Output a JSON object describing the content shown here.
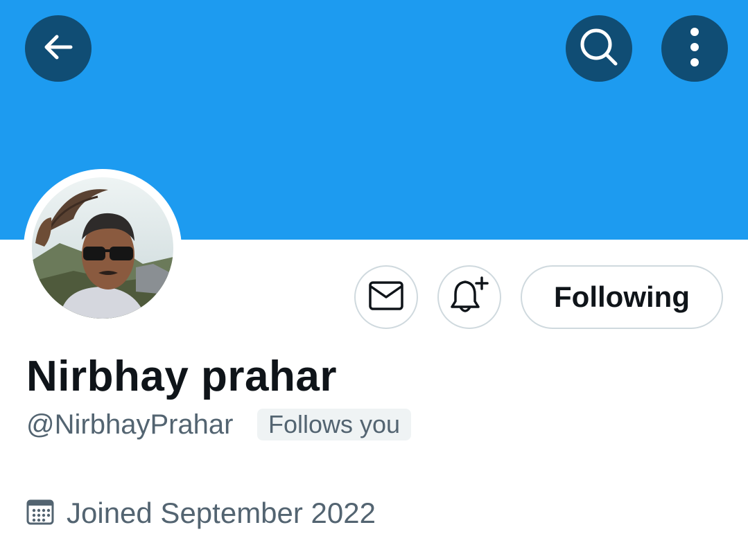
{
  "header": {
    "back_icon": "arrow-left-icon",
    "search_icon": "search-icon",
    "more_icon": "more-vertical-icon",
    "banner_color": "#1d9bf0",
    "button_color": "#104d74"
  },
  "profile": {
    "display_name": "Nirbhay prahar",
    "handle": "@NirbhayPrahar",
    "follows_you_label": "Follows you",
    "joined_text": "Joined September 2022",
    "avatar_description": "man in sunglasses with an eagle"
  },
  "actions": {
    "message_icon": "envelope-icon",
    "notify_icon": "bell-plus-icon",
    "following_label": "Following"
  },
  "colors": {
    "text_primary": "#0f1419",
    "text_secondary": "#536471",
    "border": "#cfd9de"
  }
}
